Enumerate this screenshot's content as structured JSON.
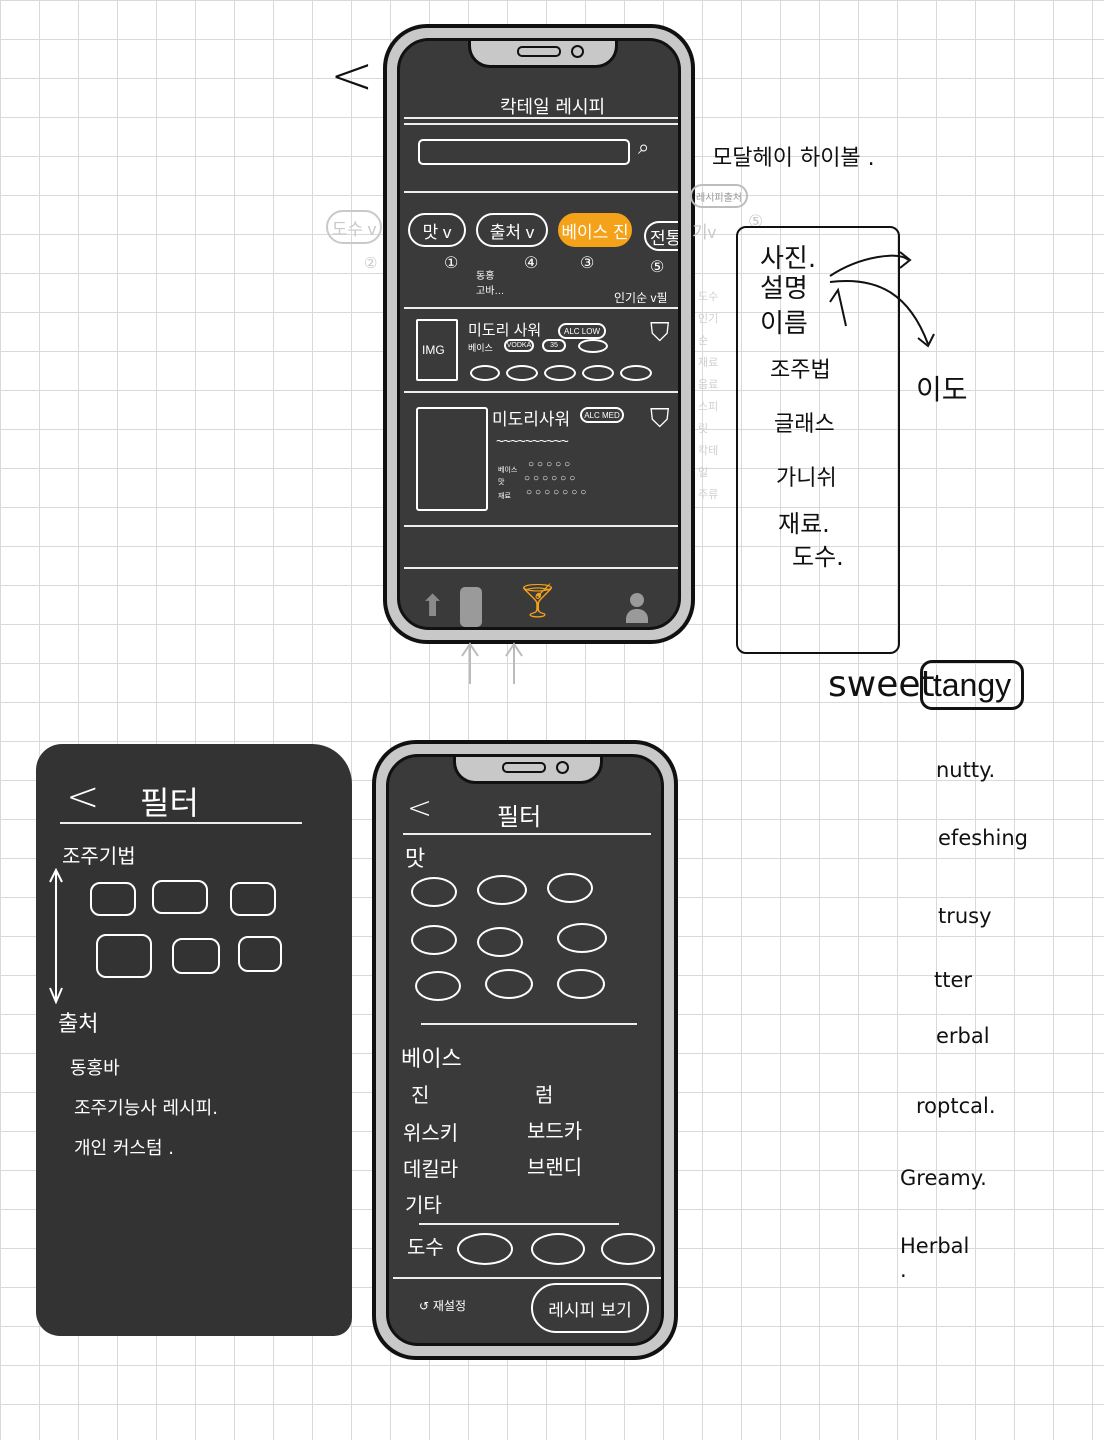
{
  "top_phone": {
    "title": "칵테일 레시피",
    "search_icon": "search-icon",
    "filters": [
      {
        "label": "맛 v",
        "num": "①"
      },
      {
        "label": "출처 v",
        "num": "④"
      },
      {
        "label": "베이스 진",
        "num": "③"
      },
      {
        "label": "전통",
        "num": "⑤"
      }
    ],
    "filter_sub": "동홍 고바…",
    "sort_label": "인기순 v필",
    "card1": {
      "img_label": "IMG",
      "name": "미도리 사워",
      "alc_badge": "ALC LOW",
      "base_label": "베이스",
      "base_chip": "VODKA",
      "chip2": "35"
    },
    "card2": {
      "name": "미도리사워",
      "alc_badge": "ALC MED",
      "row_labels": [
        "베이스",
        "맛",
        "재료"
      ]
    },
    "nav": [
      "home-icon",
      "fridge-icon",
      "cocktail-glass-icon",
      "profile-icon"
    ]
  },
  "annotations": {
    "back_chevron": "<",
    "modal_note": "모달헤이 하이볼 .",
    "recipe_tag": "레시피출처",
    "ghost_chip": "도수 v",
    "ghost_chip_num": "②",
    "ghost_chip2": "기v",
    "ghost_num5": "⑤",
    "ghost_side": [
      "도수",
      "인기순",
      "재료",
      "음료",
      "스피릿",
      "칵테일",
      "주류"
    ],
    "panel_items": [
      "사진.",
      "설명",
      "이름",
      "조주법",
      "글래스",
      "가니쉬",
      "재료.",
      "도수."
    ],
    "arrow_label": "이도",
    "sweet": "sweet",
    "tangy": "tangy",
    "taste_words": [
      "nutty.",
      "efeshing",
      "trusy",
      "tter",
      "erbal",
      "roptcal.",
      "Greamy.",
      "Herbal ."
    ]
  },
  "left_panel": {
    "back": "<",
    "title": "필터",
    "sec1": "조주기법",
    "sec2": "출처",
    "items": [
      "동홍바",
      "조주기능사 레시피.",
      "개인 커스텀 ."
    ]
  },
  "filter_phone": {
    "back": "<",
    "title": "필터",
    "taste_label": "맛",
    "base_label": "베이스",
    "bases": [
      "진",
      "럼",
      "위스키",
      "보드카",
      "데킬라",
      "브랜디",
      "기타"
    ],
    "abv_label": "도수",
    "reset": "↺ 재설정",
    "submit": "레시피 보기"
  },
  "colors": {
    "accent": "#f5a21b",
    "screen": "#3a3a3a",
    "frame": "#c8c8c8"
  }
}
